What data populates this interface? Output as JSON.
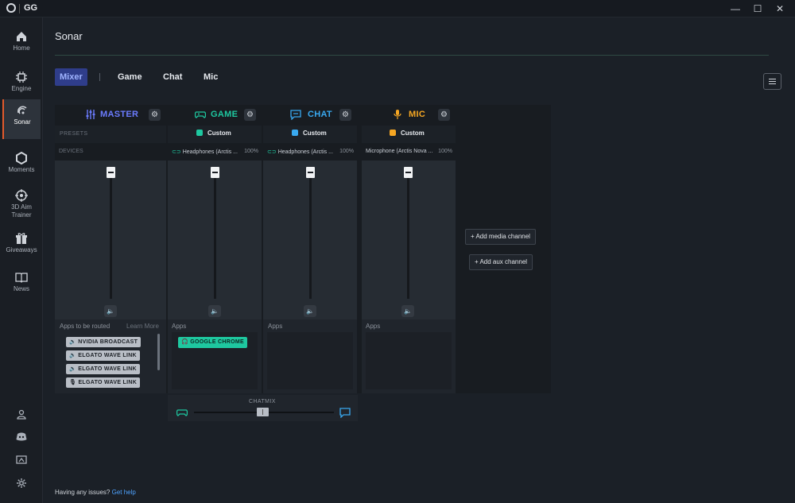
{
  "app": {
    "title": "GG"
  },
  "window": {
    "minimize": "—",
    "maximize": "☐",
    "close": "✕"
  },
  "sidebar": {
    "items": [
      {
        "label": "Home",
        "icon": "home-icon"
      },
      {
        "label": "Engine",
        "icon": "chip-icon"
      },
      {
        "label": "Sonar",
        "icon": "sonar-icon"
      },
      {
        "label": "Moments",
        "icon": "hexagon-icon"
      },
      {
        "label": "3D Aim Trainer",
        "icon": "target-icon"
      },
      {
        "label": "Giveaways",
        "icon": "gift-icon"
      },
      {
        "label": "News",
        "icon": "book-icon"
      }
    ],
    "active": "Sonar",
    "footer_icons": [
      "account-icon",
      "discord-icon",
      "feedback-icon",
      "settings-icon"
    ]
  },
  "page": {
    "title": "Sonar"
  },
  "tabs": [
    {
      "label": "Mixer",
      "active": true
    },
    {
      "label": "Game",
      "active": false
    },
    {
      "label": "Chat",
      "active": false
    },
    {
      "label": "Mic",
      "active": false
    }
  ],
  "mixer": {
    "presets_label": "PRESETS",
    "devices_label": "DEVICES",
    "channels": [
      {
        "name": "MASTER",
        "color": "#6b7cff",
        "icon": "sliders-icon"
      },
      {
        "name": "GAME",
        "color": "#1ec8a0",
        "icon": "gamepad-icon",
        "preset": "Custom",
        "preset_color": "#1ec8a0",
        "device": "Headphones (Arctis ...",
        "device_volume": "100%"
      },
      {
        "name": "CHAT",
        "color": "#39a9f0",
        "icon": "chat-icon",
        "preset": "Custom",
        "preset_color": "#39a9f0",
        "device": "Headphones (Arctis ...",
        "device_volume": "100%"
      },
      {
        "name": "MIC",
        "color": "#f5a623",
        "icon": "microphone-icon",
        "preset": "Custom",
        "preset_color": "#f5a623",
        "device": "Microphone (Arctis Nova ...",
        "device_volume": "100%"
      }
    ],
    "apps_to_route_label": "Apps to be routed",
    "learn_more": "Learn More",
    "apps_label": "Apps",
    "unrouted_apps": [
      "NVIDIA BROADCAST",
      "ELGATO WAVE LINK",
      "ELGATO WAVE LINK",
      "ELGATO WAVE LINK"
    ],
    "game_apps": [
      "GOOGLE CHROME"
    ],
    "add_media_channel": "+ Add media channel",
    "add_aux_channel": "+ Add aux channel",
    "chatmix_label": "CHATMIX"
  },
  "footer": {
    "help_text": "Having any issues?",
    "help_link": "Get help"
  }
}
